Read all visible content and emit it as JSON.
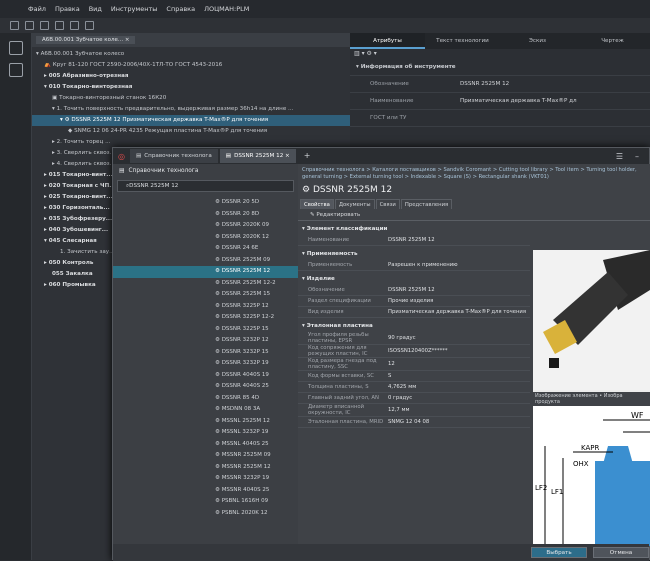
{
  "menu": {
    "items": [
      "Файл",
      "Правка",
      "Вид",
      "Инструменты",
      "Справка",
      "ЛОЦМАН:PLM"
    ]
  },
  "tree": {
    "tab": "А6В.00.001 Зубчатое коле... ×",
    "rows": [
      {
        "t": "▾ А6В.00.001 Зубчатое колесо",
        "i": 4,
        "b": false
      },
      {
        "t": "⛺ Круг 81-120 ГОСТ 2590-2006/40Х-1ТЛ-ТО ГОСТ 4543-2016",
        "i": 12,
        "b": false
      },
      {
        "t": "▸ 005 Абразивно-отрезная",
        "i": 12,
        "b": true
      },
      {
        "t": "▾ 010 Токарно-винторезная",
        "i": 12,
        "b": true
      },
      {
        "t": "▣ Токарно-винторезный станок 16К20",
        "i": 20,
        "b": false
      },
      {
        "t": "▾ 1. Точить поверхность предварительно, выдерживая размер 36h14 на длине ...",
        "i": 20,
        "b": false
      },
      {
        "t": "▾ ⚙ DSSNR 2525M 12 Призматическая державка T-Max®P для точения",
        "i": 28,
        "b": false,
        "sel": true
      },
      {
        "t": "◆ SNMG 12 06 24-PR   4235 Режущая пластина T-Max®P для точения",
        "i": 36,
        "b": false
      },
      {
        "t": "▸ 2. Точить торец ...",
        "i": 20,
        "b": false
      },
      {
        "t": "▸ 3. Сверлить сквоз...",
        "i": 20,
        "b": false
      },
      {
        "t": "▸ 4. Сверлить сквоз...",
        "i": 20,
        "b": false
      },
      {
        "t": "▸ 015 Токарно-винт...",
        "i": 12,
        "b": true
      },
      {
        "t": "▸ 020 Токарная с ЧП...",
        "i": 12,
        "b": true
      },
      {
        "t": "▸ 025 Токарно-винт...",
        "i": 12,
        "b": true
      },
      {
        "t": "▸ 030 Горизонталь...",
        "i": 12,
        "b": true
      },
      {
        "t": "▸ 035 Зубофрезеру...",
        "i": 12,
        "b": true
      },
      {
        "t": "▸ 040 Зубошевинг...",
        "i": 12,
        "b": true
      },
      {
        "t": "▾ 045 Слесарная",
        "i": 12,
        "b": true
      },
      {
        "t": "1. Зачистить зау...",
        "i": 28,
        "b": false
      },
      {
        "t": "▸ 050 Контроль",
        "i": 12,
        "b": true
      },
      {
        "t": "055 Закалка",
        "i": 20,
        "b": true
      },
      {
        "t": "▸ 060 Промывка",
        "i": 12,
        "b": true
      }
    ]
  },
  "attr": {
    "tabs": [
      "Атрибуты",
      "Текст технологии",
      "Эскиз",
      "Чертеж"
    ],
    "section": "▾ Информация об инструменте",
    "rows": [
      {
        "k": "Обозначение",
        "v": "DSSNR 2525M 12"
      },
      {
        "k": "Наименование",
        "v": "Призматическая державка T-Max®P дл"
      },
      {
        "k": "ГОСТ или ТУ",
        "v": ""
      }
    ]
  },
  "dialog": {
    "tabs": [
      "Справочник технолога",
      "DSSNR 2525M 12 ×",
      "+"
    ],
    "left_header": "Справочник технолога",
    "search": "DSSNR 2525M 12",
    "items": [
      "DSSNR 20 5D",
      "DSSNR 20 8D",
      "DSSNR 2020K 09",
      "DSSNR 2020K 12",
      "DSSNR 24 6E",
      "DSSNR 2525M 09",
      "DSSNR 2525M 12",
      "DSSNR 2525M 12-2",
      "DSSNR 2525M 15",
      "DSSNR 3225P 12",
      "DSSNR 3225P 12-2",
      "DSSNR 3225P 15",
      "DSSNR 3232P 12",
      "DSSNR 3232P 15",
      "DSSNR 3232P 19",
      "DSSNR 4040S 19",
      "DSSNR 4040S 25",
      "DSSNR 85 4D",
      "MSDNN 08 3A",
      "MSSNL 2525M 12",
      "MSSNL 3232P 19",
      "MSSNL 4040S 25",
      "MSSNR 2525M 09",
      "MSSNR 2525M 12",
      "MSSNR 3232P 19",
      "MSSNR 4040S 25",
      "PSBNL 1616H 09",
      "PSBNL 2020K 12"
    ],
    "selected_index": 6,
    "breadcrumb": "Справочник технолога > Каталоги поставщиков > Sandvik Coromant > Cutting tool library > Tool item > Turning tool holder, general turning > External turning tool > Indexable > Square (S) > Rectangular shank (VKT01)",
    "title": "DSSNR 2525M 12",
    "prop_tabs": [
      "Свойства",
      "Документы",
      "Связи",
      "Представления"
    ],
    "edit": "Редактировать",
    "sec1": "▾ Элемент классификации",
    "s1": [
      {
        "k": "Наименование",
        "v": "DSSNR 2525M 12"
      }
    ],
    "sec2": "▾ Применяемость",
    "s2": [
      {
        "k": "Применяемость",
        "v": "Разрешен к применению"
      }
    ],
    "sec3": "▾ Изделие",
    "s3": [
      {
        "k": "Обозначение",
        "v": "DSSNR 2525M 12"
      },
      {
        "k": "Раздел спецификации",
        "v": "Прочие изделия"
      },
      {
        "k": "Вид изделия",
        "v": "Призматическая державка T-Max®P для точения"
      }
    ],
    "sec4": "▾ Эталонная пластина",
    "s4": [
      {
        "k": "Угол профиля резьбы пластины, EPSR",
        "v": "90   градус"
      },
      {
        "k": "Код сопряжения для режущих пластин, IC",
        "v": "ISOSSN120400Z******"
      },
      {
        "k": "Код размера гнезда под пластину, SSC",
        "v": "12"
      },
      {
        "k": "Код формы вставки, SC",
        "v": "S"
      },
      {
        "k": "Толщина пластины, S",
        "v": "4,7625   мм"
      },
      {
        "k": "Главный задний угол, AN",
        "v": "0   градус"
      },
      {
        "k": "Диаметр вписанной окружности, IC",
        "v": "12,7   мм"
      },
      {
        "k": "Эталонная пластина, MRID",
        "v": "SNMG 12 04 08"
      }
    ],
    "image_caption": "Изображение элемента  •  Изобра продукта",
    "dims": [
      "WF",
      "KAPR",
      "OHX",
      "LF2",
      "LF1"
    ],
    "buttons": {
      "select": "Выбрать",
      "cancel": "Отмена"
    }
  }
}
